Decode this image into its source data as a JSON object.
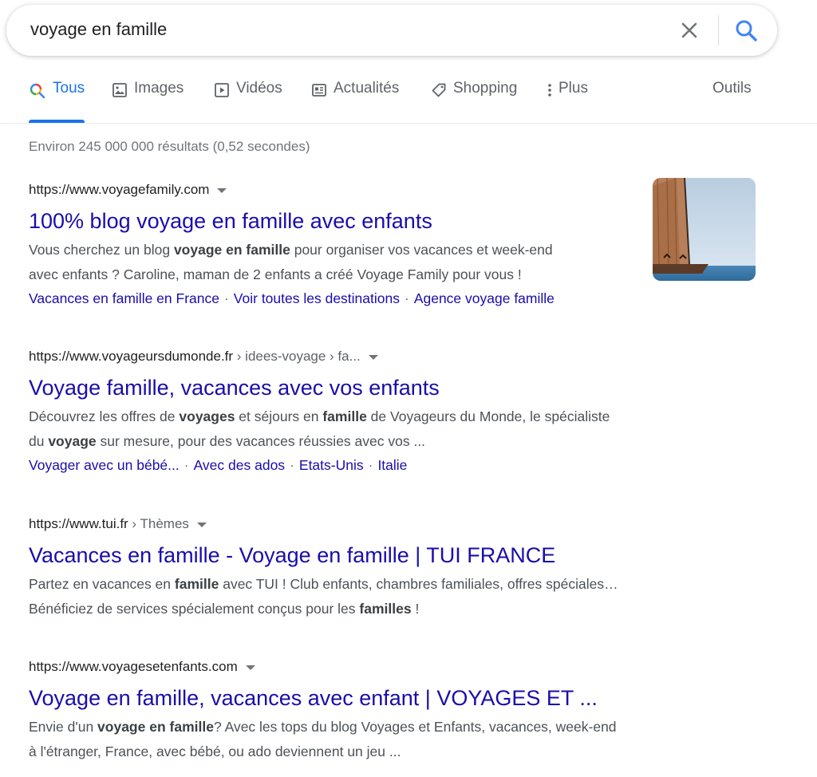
{
  "search": {
    "query": "voyage en famille"
  },
  "tabs": [
    {
      "label": "Tous",
      "icon": "search-multicolor-icon",
      "active": true
    },
    {
      "label": "Images",
      "icon": "image-icon"
    },
    {
      "label": "Vidéos",
      "icon": "video-icon"
    },
    {
      "label": "Actualités",
      "icon": "news-icon"
    },
    {
      "label": "Shopping",
      "icon": "tag-icon"
    },
    {
      "label": "Plus",
      "icon": "more-vertical-icon"
    }
  ],
  "tools_label": "Outils",
  "stats": "Environ 245 000 000 résultats (0,52 secondes)",
  "results": [
    {
      "url": "https://www.voyagefamily.com",
      "breadcrumb": "",
      "title": "100% blog voyage en famille avec enfants",
      "snippet_lines": [
        [
          {
            "t": "Vous cherchez un blog "
          },
          {
            "t": "voyage en famille",
            "b": true
          },
          {
            "t": " pour organiser vos vacances et week-end"
          }
        ],
        [
          {
            "t": "avec enfants ? Caroline, maman de 2 enfants a créé Voyage Family pour vous !"
          }
        ]
      ],
      "sitelinks": [
        "Vacances en famille en France",
        "Voir toutes les destinations",
        "Agence voyage famille"
      ],
      "thumbnail": "sailboat-photo"
    },
    {
      "url": "https://www.voyageursdumonde.fr",
      "breadcrumb": " › idees-voyage › fa...",
      "title": "Voyage famille, vacances avec vos enfants",
      "snippet_lines": [
        [
          {
            "t": "Découvrez les offres de "
          },
          {
            "t": "voyages",
            "b": true
          },
          {
            "t": " et séjours en "
          },
          {
            "t": "famille",
            "b": true
          },
          {
            "t": " de Voyageurs du Monde, le spécialiste"
          }
        ],
        [
          {
            "t": "du "
          },
          {
            "t": "voyage",
            "b": true
          },
          {
            "t": " sur mesure, pour des vacances réussies avec vos ..."
          }
        ]
      ],
      "sitelinks": [
        "Voyager avec un bébé...",
        "Avec des ados",
        "Etats-Unis",
        "Italie"
      ]
    },
    {
      "url": "https://www.tui.fr",
      "breadcrumb": " › Thèmes",
      "title": "Vacances en famille - Voyage en famille | TUI FRANCE",
      "snippet_lines": [
        [
          {
            "t": "Partez en vacances en "
          },
          {
            "t": "famille",
            "b": true
          },
          {
            "t": " avec TUI ! Club enfants, chambres familiales, offres spéciales…"
          }
        ],
        [
          {
            "t": "Bénéficiez de services spécialement conçus pour les "
          },
          {
            "t": "familles",
            "b": true
          },
          {
            "t": " !"
          }
        ]
      ],
      "sitelinks": []
    },
    {
      "url": "https://www.voyagesetenfants.com",
      "breadcrumb": "",
      "title": "Voyage en famille, vacances avec enfant | VOYAGES ET ...",
      "snippet_lines": [
        [
          {
            "t": "Envie d'un "
          },
          {
            "t": "voyage en famille",
            "b": true
          },
          {
            "t": "? Avec les tops du blog Voyages et Enfants, vacances, week-end"
          }
        ],
        [
          {
            "t": "à l'étranger, France, avec bébé, ou ado deviennent un jeu ..."
          }
        ]
      ],
      "sitelinks": []
    }
  ],
  "colors": {
    "link": "#1a0dab",
    "accent": "#1a73e8",
    "muted": "#5f6368"
  }
}
